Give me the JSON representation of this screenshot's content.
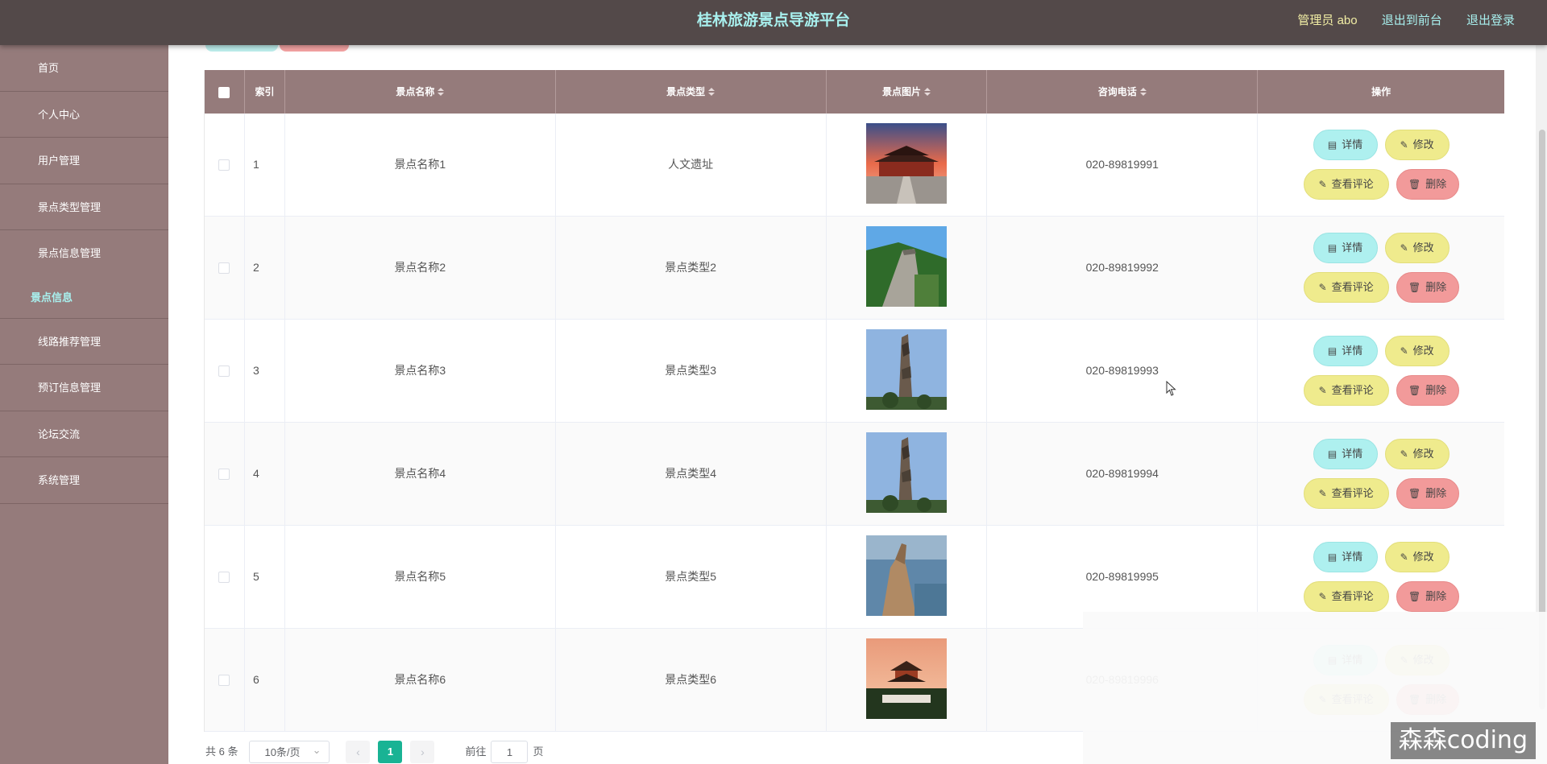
{
  "header": {
    "title": "桂林旅游景点导游平台",
    "user": "管理员 abo",
    "links": [
      "退出到前台",
      "退出登录"
    ]
  },
  "sidebar": {
    "items": [
      "首页",
      "个人中心",
      "用户管理",
      "景点类型管理",
      "景点信息管理"
    ],
    "active_sub": "景点信息",
    "items_after": [
      "线路推荐管理",
      "预订信息管理",
      "论坛交流",
      "系统管理"
    ]
  },
  "table": {
    "columns": [
      "索引",
      "景点名称",
      "景点类型",
      "景点图片",
      "咨询电话",
      "操作"
    ],
    "rows": [
      {
        "index": "1",
        "name": "景点名称1",
        "type": "人文遗址",
        "image": "palace",
        "phone": "020-89819991"
      },
      {
        "index": "2",
        "name": "景点名称2",
        "type": "景点类型2",
        "image": "great-wall",
        "phone": "020-89819992"
      },
      {
        "index": "3",
        "name": "景点名称3",
        "type": "景点类型3",
        "image": "stone-pillar",
        "phone": "020-89819993"
      },
      {
        "index": "4",
        "name": "景点名称4",
        "type": "景点类型4",
        "image": "stone-pillar",
        "phone": "020-89819994"
      },
      {
        "index": "5",
        "name": "景点名称5",
        "type": "景点类型5",
        "image": "sea-rock",
        "phone": "020-89819995"
      },
      {
        "index": "6",
        "name": "景点名称6",
        "type": "景点类型6",
        "image": "pavilion",
        "phone": "020-89819996"
      }
    ],
    "actions": {
      "detail": "详情",
      "edit": "修改",
      "comment": "查看评论",
      "delete": "删除"
    }
  },
  "pagination": {
    "total": "共 6 条",
    "page_size": "10条/页",
    "current_page": "1",
    "goto_label": "前往",
    "goto_value": "1",
    "page_suffix": "页"
  },
  "watermark": "森森coding",
  "colors": {
    "header": "#534949",
    "sidebar": "#957b7b",
    "accent_text": "#a8f0ee",
    "pager_active": "#19b394"
  }
}
